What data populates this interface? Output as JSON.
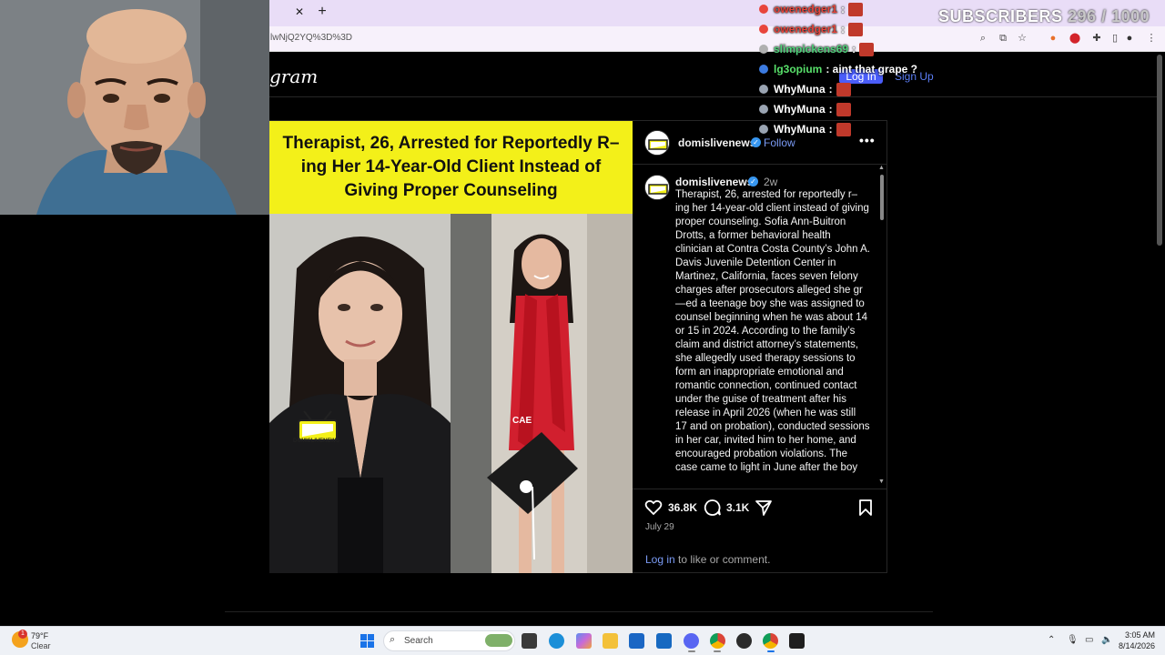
{
  "browser": {
    "url_fragment": "lwNjQ2YQ%3D%3D",
    "tab_close_glyph": "✕",
    "new_tab_glyph": "+"
  },
  "instagram": {
    "logo_text": "gram",
    "login_label": "Log In",
    "signup_label": "Sign Up"
  },
  "post": {
    "image_headline": "Therapist, 26, Arrested for Reportedly R–ing Her 14-Year-Old Client Instead of Giving Proper Counseling",
    "watermark_text": "DOMISLIVENEWS",
    "author": "domislivenews",
    "follow_label": "Follow",
    "more_label": "•••",
    "age": "2w",
    "caption": "Therapist, 26, arrested for reportedly r–ing her 14-year-old client instead of giving proper counseling. Sofia Ann-Buitron Drotts, a former behavioral health clinician at Contra Costa County’s John A. Davis Juvenile Detention Center in Martinez, California, faces seven felony charges after prosecutors alleged she gr—ed a teenage boy she was assigned to counsel beginning when he was about 14 or 15 in 2024. According to the family’s claim and district attorney’s statements, she allegedly used therapy sessions to form an inappropriate emotional and romantic connection, continued contact under the guise of treatment after his release in April 2026 (when he was still 17 and on probation), conducted sessions in her car, invited him to her home, and encouraged probation violations. The case came to light in June after the boy",
    "likes": "36.8K",
    "comments": "3.1K",
    "date": "July 29",
    "login_prompt_link": "Log in",
    "login_prompt_rest": " to like or comment."
  },
  "overlay": {
    "subs_label": "SUBSCRIBERS",
    "subs_count": "296 / 1000",
    "chat": [
      {
        "user": "owenedger1",
        "message": ":",
        "name_color": "#e8453c",
        "badge_color": "#e8453c"
      },
      {
        "user": "owenedger1",
        "message": ":",
        "name_color": "#e8453c",
        "badge_color": "#e8453c"
      },
      {
        "user": "slimpickens69",
        "message": ":",
        "name_color": "#4fd17a",
        "badge_color": "#b0b0b0"
      },
      {
        "user": "lg3opium",
        "message": ": aint that grape ?",
        "name_color": "#58e06a",
        "badge_color": "#3c7be0"
      },
      {
        "user": "WhyMuna",
        "message": ":",
        "name_color": "#ffffff",
        "badge_color": "#9aa4b2"
      },
      {
        "user": "WhyMuna",
        "message": ":",
        "name_color": "#ffffff",
        "badge_color": "#9aa4b2"
      },
      {
        "user": "WhyMuna",
        "message": ":",
        "name_color": "#ffffff",
        "badge_color": "#9aa4b2"
      }
    ]
  },
  "taskbar": {
    "weather_temp": "79°F",
    "weather_condition": "Clear",
    "weather_badge": "1",
    "search_label": "Search",
    "time": "3:05 AM",
    "date": "8/14/2026"
  },
  "colors": {
    "headline_bg": "#f3f019",
    "link_blue": "#7b9bf5",
    "login_button": "#4a5df9",
    "taskbar_bg": "#eef1f6"
  }
}
